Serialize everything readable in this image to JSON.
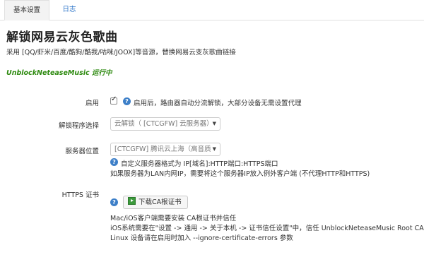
{
  "tabs": {
    "basic": "基本设置",
    "log": "日志"
  },
  "header": {
    "title": "解锁网易云灰色歌曲",
    "description": "采用 [QQ/虾米/百度/酷狗/酷我/咕咪/JOOX]等音源，替换网易云变灰歌曲链接"
  },
  "status": "UnblockNeteaseMusic 运行中",
  "form": {
    "enable": {
      "label": "启用",
      "checked": true,
      "help": "启用后，路由器自动分流解锁，大部分设备无需设置代理"
    },
    "program": {
      "label": "解锁程序选择",
      "value": "云解锁（ [CTCGFW] 云服务器）"
    },
    "server": {
      "label": "服务器位置",
      "value": "[CTCGFW] 腾讯云上海（高音质",
      "help1": "自定义服务器格式为 IP[域名]:HTTP端口:HTTPS端口",
      "help2": "如果服务器为LAN内网IP，需要将这个服务器IP放入例外客户端 (不代理HTTP和HTTPS)"
    },
    "https_cert": {
      "label": "HTTPS 证书",
      "button": "下载CA根证书",
      "note1": "Mac/iOS客户端需要安装 CA根证书并信任",
      "note2": "iOS系统需要在\"设置 -> 通用 -> 关于本机 -> 证书信任设置\"中，信任 UnblockNeteaseMusic Root CA",
      "note3": "Linux 设备请在启用时加入 --ignore-certificate-errors 参数"
    }
  },
  "colors": {
    "accent": "#2a73c8",
    "status": "#2e8a10",
    "help_icon": "#3d7fc8"
  }
}
